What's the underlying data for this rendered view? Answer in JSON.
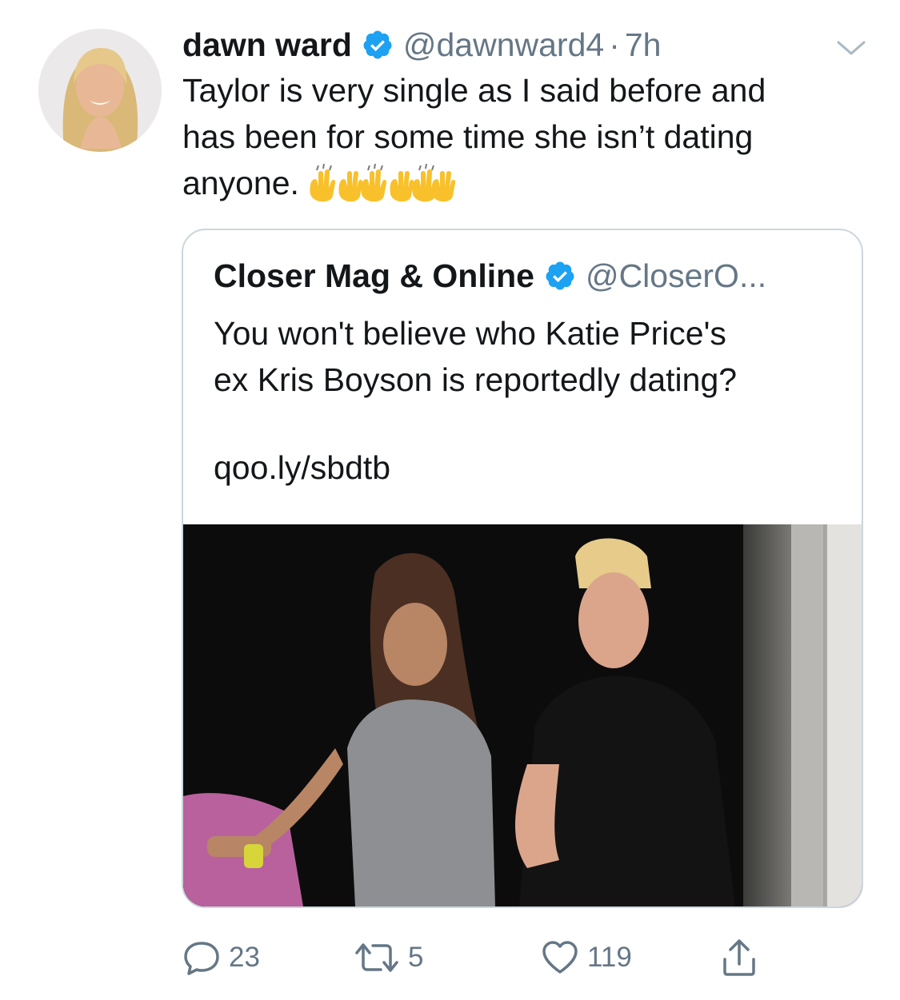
{
  "tweet": {
    "display_name": "dawn ward",
    "handle": "@dawnward4",
    "separator": "·",
    "time": "7h",
    "text_lines": [
      "Taylor is very single as I said before and",
      "has been for some time she isn’t dating",
      "anyone."
    ],
    "emoji": [
      "raising-hands-emoji",
      "raising-hands-emoji",
      "raising-hands-emoji"
    ]
  },
  "quoted": {
    "display_name": "Closer Mag & Online",
    "handle": "@CloserO...",
    "text_lines": [
      "You won't believe who Katie Price's",
      "ex Kris Boyson is reportedly dating?"
    ],
    "link": "qoo.ly/sbdtb"
  },
  "actions": {
    "replies": "23",
    "retweets": "5",
    "likes": "119"
  },
  "colors": {
    "primary_text": "#14171a",
    "secondary_text": "#657786",
    "verified_blue": "#1da1f2",
    "border": "#ccd6dd"
  },
  "icons": [
    "verified-badge-icon",
    "chevron-down-icon",
    "reply-icon",
    "retweet-icon",
    "like-icon",
    "share-icon"
  ]
}
